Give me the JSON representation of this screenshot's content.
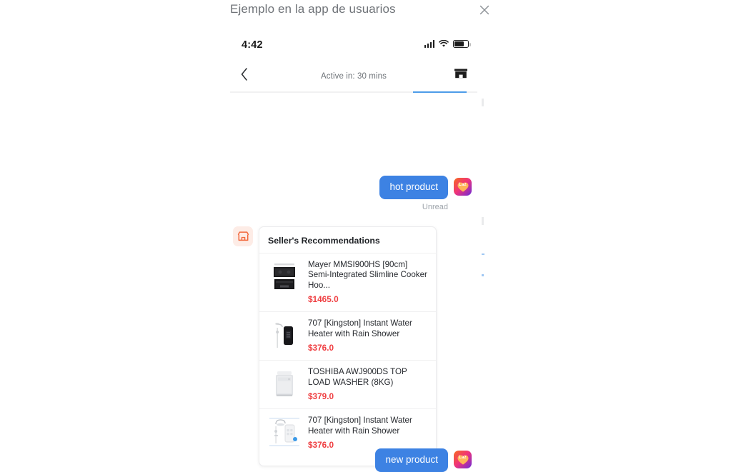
{
  "modal": {
    "title": "Ejemplo en la app de usuarios",
    "close_icon": "close-icon"
  },
  "phone": {
    "status_bar": {
      "time": "4:42",
      "signal_icon": "cellular-signal-icon",
      "wifi_icon": "wifi-icon",
      "battery_icon": "battery-icon",
      "battery_level": "62%"
    },
    "nav_bar": {
      "back_icon": "chevron-left-icon",
      "title": "Active in: 30 mins",
      "store_icon": "storefront-icon",
      "accent_color": "#4d9ce8"
    }
  },
  "chat": {
    "messages": [
      {
        "id": "msg-hot-product",
        "direction": "outgoing",
        "text": "hot product",
        "status": "Unread",
        "avatar_icon": "lazada-avatar-icon",
        "avatar_label": "Laz"
      },
      {
        "id": "msg-seller-recommendations",
        "direction": "incoming",
        "avatar_icon": "storefront-avatar-icon",
        "card": {
          "title": "Seller's Recommendations",
          "products": [
            {
              "name": "Mayer MMSI900HS [90cm] Semi-Integrated Slimline Cooker Hoo...",
              "price": "$1465.0",
              "thumb_icon": "cooker-hood-oven-thumb"
            },
            {
              "name": "707 [Kingston] Instant Water Heater with Rain Shower",
              "price": "$376.0",
              "thumb_icon": "black-water-heater-thumb"
            },
            {
              "name": "TOSHIBA AWJ900DS TOP LOAD WASHER (8KG)",
              "price": "$379.0",
              "thumb_icon": "top-load-washer-thumb"
            },
            {
              "name": "707 [Kingston] Instant Water Heater with Rain Shower",
              "price": "$376.0",
              "thumb_icon": "white-water-heater-thumb"
            }
          ]
        }
      },
      {
        "id": "msg-new-product",
        "direction": "outgoing",
        "text": "new product",
        "avatar_icon": "lazada-avatar-icon",
        "avatar_label": "Laz"
      }
    ]
  },
  "colors": {
    "bubble_blue": "#3d82e3",
    "price_red": "#ef3f42",
    "accent_blue": "#4d9ce8",
    "store_orange": "#f2683c",
    "avatar_bg": "#fdece6"
  }
}
